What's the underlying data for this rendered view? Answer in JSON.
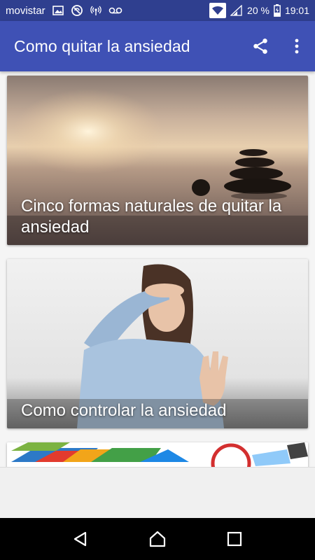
{
  "status_bar": {
    "carrier": "movistar",
    "battery": "20 %",
    "time": "19:01",
    "icons": [
      "image-icon",
      "no-sync-icon",
      "hotspot-icon",
      "voicemail-icon",
      "wifi-icon",
      "signal-icon",
      "battery-charging-icon"
    ]
  },
  "app_bar": {
    "title": "Como quitar la ansiedad",
    "actions": [
      "share-icon",
      "more-vert-icon"
    ]
  },
  "cards": [
    {
      "title": "Cinco formas naturales de quitar la ansiedad"
    },
    {
      "title": "Como controlar la ansiedad"
    },
    {
      "title": ""
    }
  ],
  "nav_bar": {
    "buttons": [
      "back-icon",
      "home-icon",
      "recents-icon"
    ]
  },
  "colors": {
    "status_bar": "#2f3f8f",
    "app_bar": "#3f51b5",
    "nav_bar": "#000000"
  }
}
